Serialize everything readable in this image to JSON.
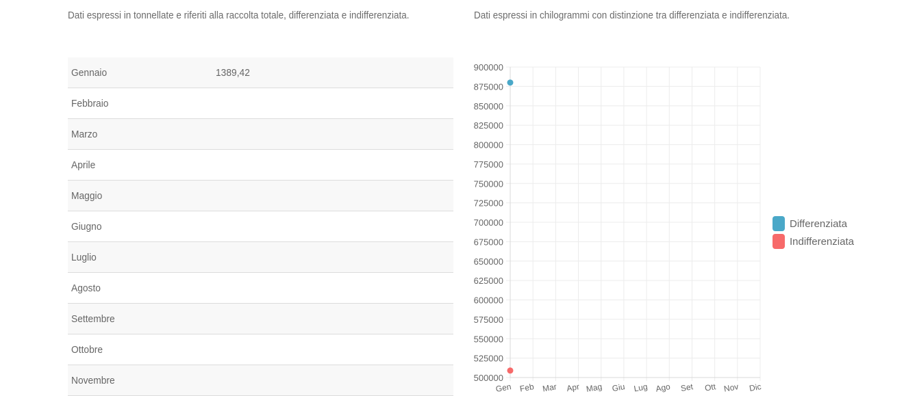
{
  "left_panel": {
    "description": "Dati espressi in tonnellate e riferiti alla raccolta totale, differenziata e indifferenziata.",
    "rows": [
      {
        "month": "Gennaio",
        "value": "1389,42"
      },
      {
        "month": "Febbraio",
        "value": ""
      },
      {
        "month": "Marzo",
        "value": ""
      },
      {
        "month": "Aprile",
        "value": ""
      },
      {
        "month": "Maggio",
        "value": ""
      },
      {
        "month": "Giugno",
        "value": ""
      },
      {
        "month": "Luglio",
        "value": ""
      },
      {
        "month": "Agosto",
        "value": ""
      },
      {
        "month": "Settembre",
        "value": ""
      },
      {
        "month": "Ottobre",
        "value": ""
      },
      {
        "month": "Novembre",
        "value": ""
      }
    ]
  },
  "right_panel": {
    "description": "Dati espressi in chilogrammi con distinzione tra differenziata e indifferenziata."
  },
  "chart_data": {
    "type": "line",
    "categories": [
      "Gen",
      "Feb",
      "Mar",
      "Apr",
      "Mag",
      "Giu",
      "Lug",
      "Ago",
      "Set",
      "Ott",
      "Nov",
      "Dic"
    ],
    "series": [
      {
        "name": "Differenziata",
        "color": "#4aa8c8",
        "values": [
          880000,
          null,
          null,
          null,
          null,
          null,
          null,
          null,
          null,
          null,
          null,
          null
        ]
      },
      {
        "name": "Indifferenziata",
        "color": "#f76a6a",
        "values": [
          509000,
          null,
          null,
          null,
          null,
          null,
          null,
          null,
          null,
          null,
          null,
          null
        ]
      }
    ],
    "ylim": [
      500000,
      900000
    ],
    "ytick_step": 25000,
    "grid": true,
    "legend": "right"
  }
}
